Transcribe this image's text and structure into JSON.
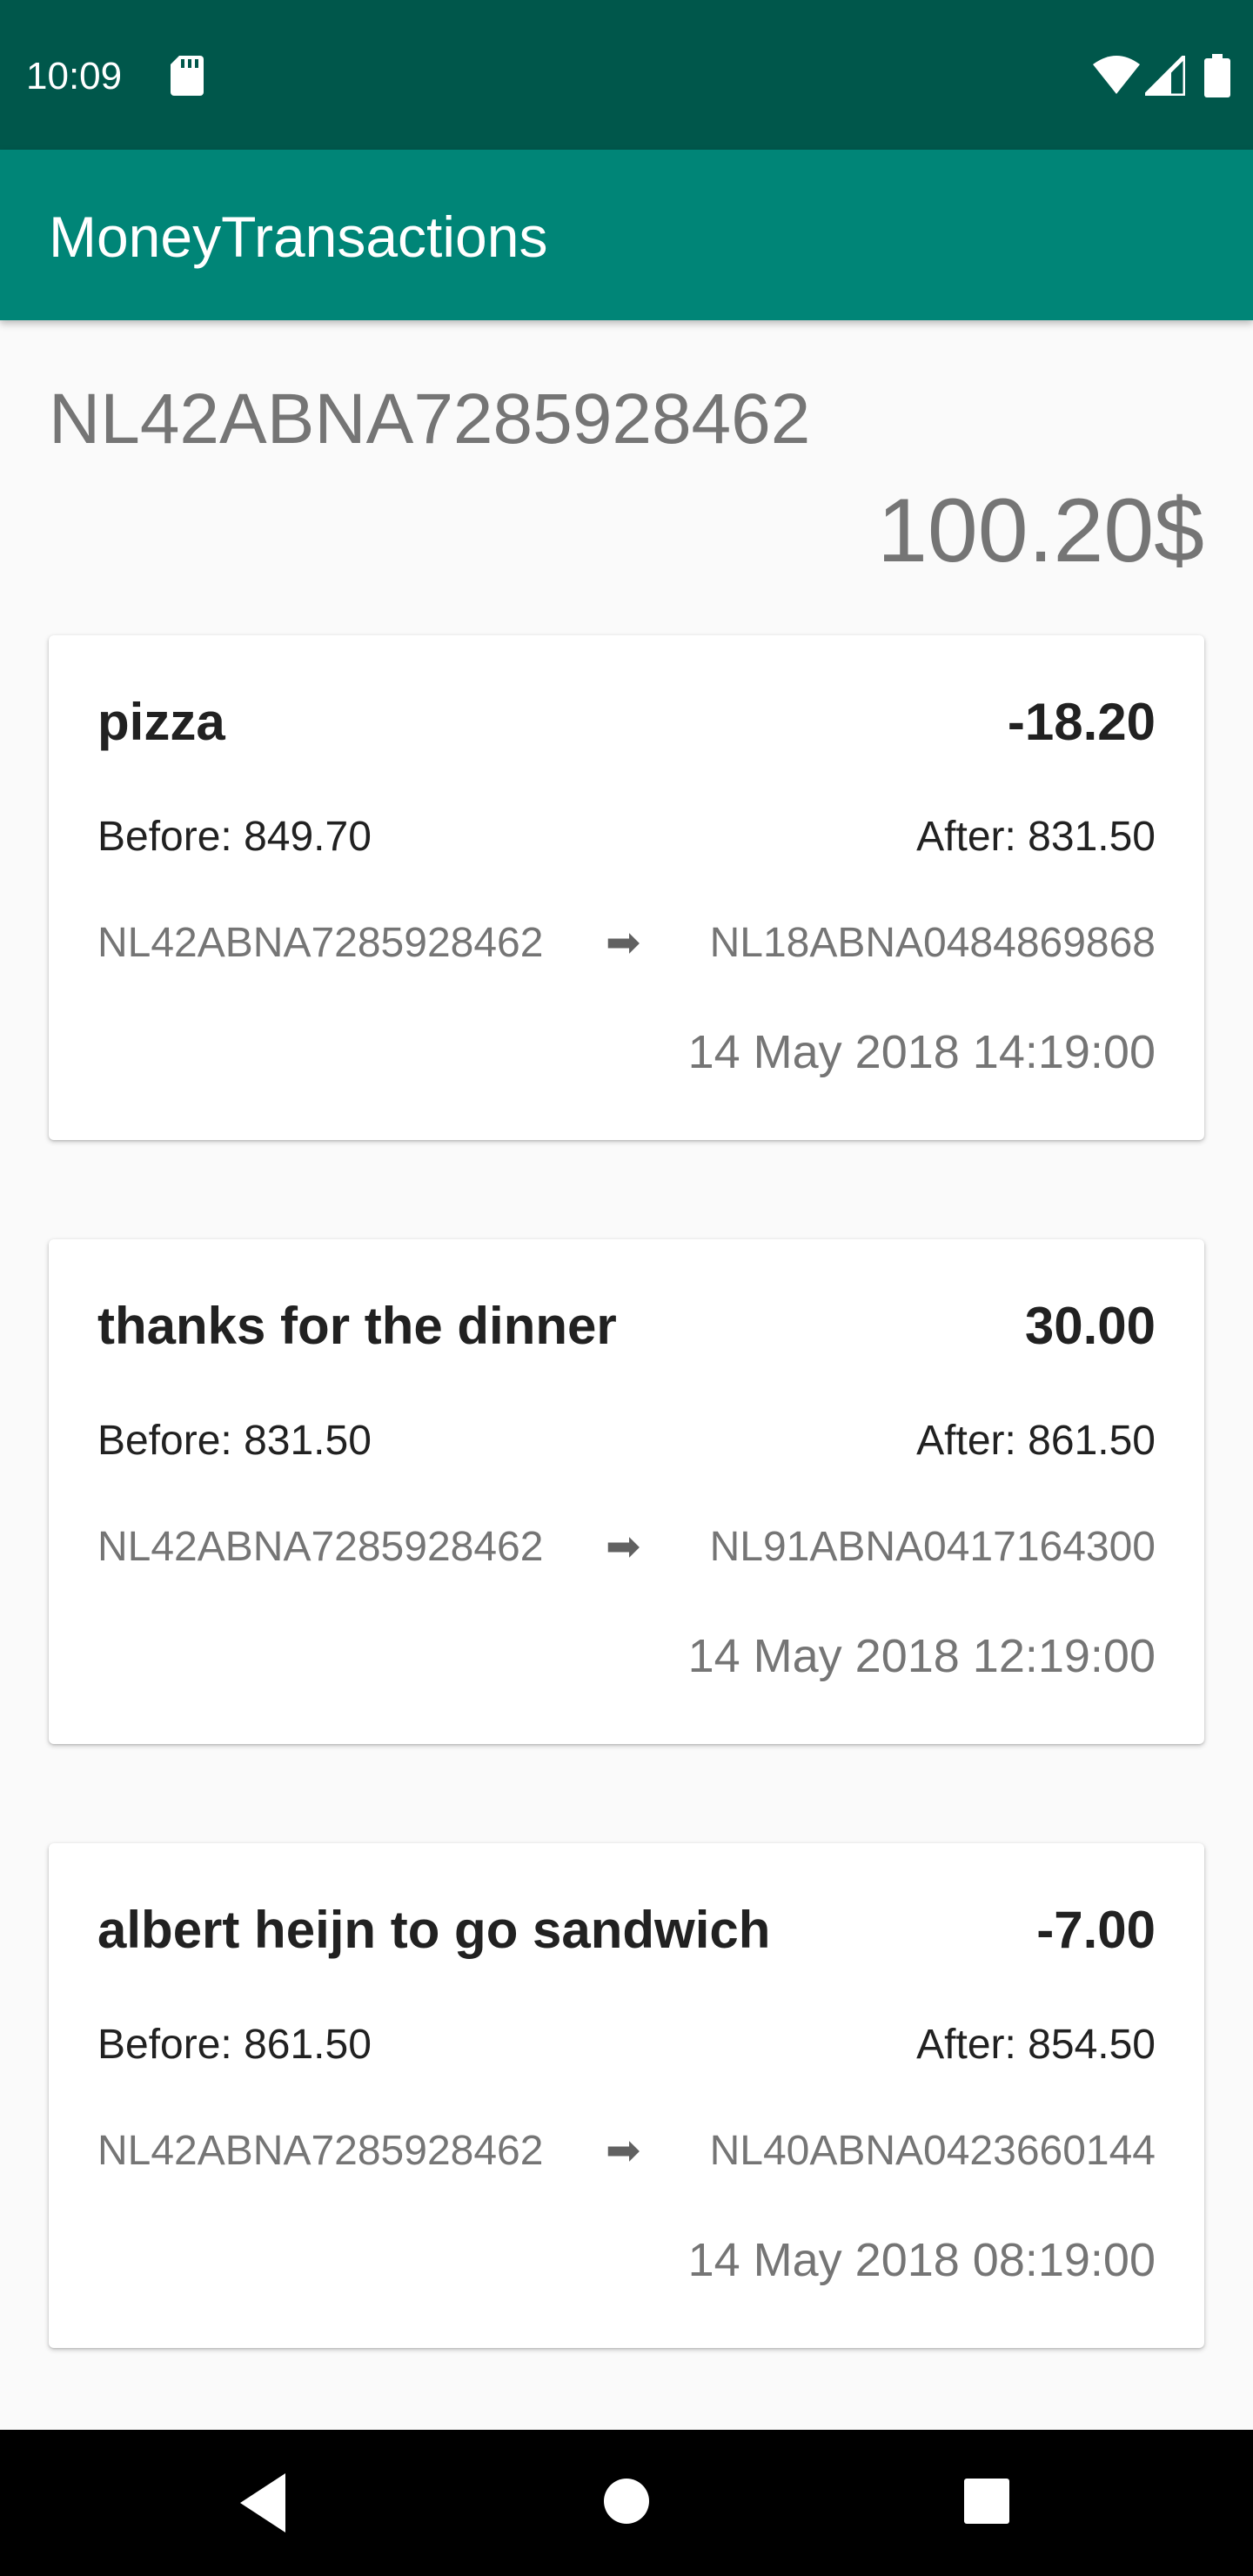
{
  "status_bar": {
    "time": "10:09",
    "icons": [
      "sd-card-icon",
      "wifi-icon",
      "cell-signal-icon",
      "battery-icon"
    ]
  },
  "app_bar": {
    "title": "MoneyTransactions"
  },
  "account": {
    "iban": "NL42ABNA7285928462",
    "balance": "100.20$"
  },
  "transactions": [
    {
      "description": "pizza",
      "amount": "-18.20",
      "before": "Before: 849.70",
      "after": "After: 831.50",
      "from": "NL42ABNA7285928462",
      "arrow": "➡",
      "to": "NL18ABNA0484869868",
      "date": "14 May 2018 14:19:00"
    },
    {
      "description": "thanks for the dinner",
      "amount": "30.00",
      "before": "Before: 831.50",
      "after": "After: 861.50",
      "from": "NL42ABNA7285928462",
      "arrow": "➡",
      "to": "NL91ABNA0417164300",
      "date": "14 May 2018 12:19:00"
    },
    {
      "description": "albert heijn to go sandwich",
      "amount": "-7.00",
      "before": "Before: 861.50",
      "after": "After: 854.50",
      "from": "NL42ABNA7285928462",
      "arrow": "➡",
      "to": "NL40ABNA0423660144",
      "date": "14 May 2018 08:19:00"
    }
  ],
  "nav_bar": {
    "icons": [
      "back-icon",
      "home-icon",
      "recents-icon"
    ]
  },
  "colors": {
    "status_bar": "#00574b",
    "app_bar": "#008577",
    "background": "#fafafa",
    "primary_text": "#212121",
    "secondary_text": "#757575"
  }
}
